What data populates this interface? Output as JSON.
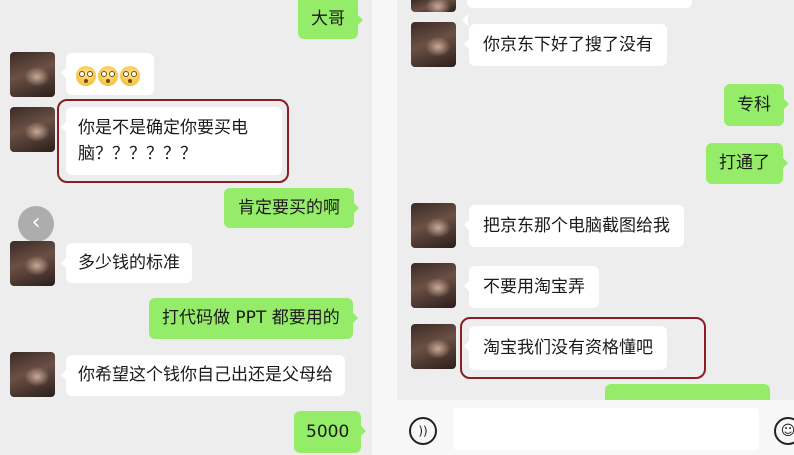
{
  "left_chat": {
    "messages": [
      {
        "side": "out",
        "text": "大哥"
      },
      {
        "side": "in",
        "emoji_faces": [
          "flushed-face-icon",
          "flushed-face-icon",
          "flushed-face-icon"
        ]
      },
      {
        "side": "in",
        "line1": "你是不是确定你要买电",
        "line2": "脑？？？？？？",
        "highlighted": true
      },
      {
        "side": "out",
        "text": "肯定要买的啊"
      },
      {
        "side": "in",
        "text": "多少钱的标准"
      },
      {
        "side": "out",
        "text": "打代码做 PPT 都要用的"
      },
      {
        "side": "in",
        "text": "你希望这个钱你自己出还是父母给"
      },
      {
        "side": "out",
        "text": "5000"
      }
    ],
    "back_button_icon": "chevron-left-icon"
  },
  "right_chat": {
    "messages": [
      {
        "side": "in",
        "text": "你京东下好了搜了没有"
      },
      {
        "side": "out",
        "text": "专科"
      },
      {
        "side": "out",
        "text": "打通了"
      },
      {
        "side": "in",
        "text": "把京东那个电脑截图给我"
      },
      {
        "side": "in",
        "text": "不要用淘宝弄"
      },
      {
        "side": "in",
        "text": "淘宝我们没有资格懂吧",
        "highlighted": true
      }
    ],
    "input_bar": {
      "voice_icon": "voice-icon",
      "emoji_icon": "smile-icon",
      "text_value": ""
    }
  },
  "colors": {
    "outgoing_bubble": "#95ec69",
    "incoming_bubble": "#ffffff",
    "highlight_border": "#8b1e24",
    "chat_background": "#ededed"
  }
}
